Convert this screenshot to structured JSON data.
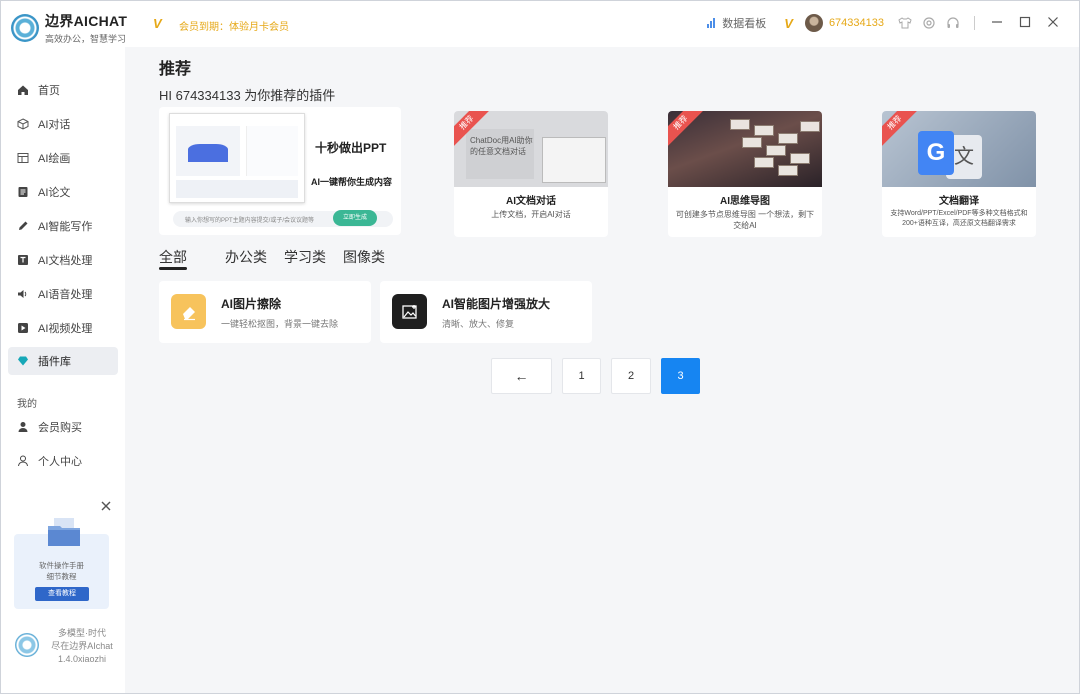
{
  "app": {
    "title": "边界AICHAT",
    "subtitle": "高效办公，智慧学习"
  },
  "topbar": {
    "vip_icon": "V",
    "vip_expiry": "会员到期：体验月卡会员",
    "dashboard": "数据看板",
    "user_id": "674334133",
    "accent": "#e6a817"
  },
  "sidebar": {
    "items": [
      {
        "label": "首页",
        "icon": "home-icon"
      },
      {
        "label": "AI对话",
        "icon": "cube-icon"
      },
      {
        "label": "AI绘画",
        "icon": "image-icon"
      },
      {
        "label": "AI论文",
        "icon": "document-icon"
      },
      {
        "label": "AI智能写作",
        "icon": "pen-icon"
      },
      {
        "label": "AI文档处理",
        "icon": "doc-text-icon"
      },
      {
        "label": "AI语音处理",
        "icon": "speaker-icon"
      },
      {
        "label": "AI视频处理",
        "icon": "play-icon"
      },
      {
        "label": "插件库",
        "icon": "gem-icon"
      }
    ],
    "section_label": "我的",
    "mine_items": [
      {
        "label": "会员购买",
        "icon": "user-icon"
      },
      {
        "label": "个人中心",
        "icon": "user-outline-icon"
      }
    ],
    "promo": {
      "line1": "软件操作手册",
      "line2": "细节教程",
      "button": "查看教程"
    },
    "version": {
      "line1": "多模型·时代",
      "line2": "尽在边界AIchat",
      "line3": "1.4.0xiaozhi"
    }
  },
  "main": {
    "title": "推荐",
    "greeting": "HI 674334133 为你推荐的插件",
    "banner": {
      "headline": "十秒做出PPT",
      "subline": "AI一键帮你生成内容",
      "input_hint": "输入你想写的PPT主题内容提交/或子/会议议题等",
      "button": "立即生成"
    },
    "cards": [
      {
        "badge": "推荐",
        "image_text_1": "ChatDoc用AI助你",
        "image_text_2": "的任意文档对话",
        "title": "AI文档对话",
        "desc": "上传文档，开启AI对话"
      },
      {
        "badge": "推荐",
        "title": "AI思维导图",
        "desc": "可创建多节点思维导图 一个想法，剩下交给AI"
      },
      {
        "badge": "推荐",
        "title": "文档翻译",
        "desc": "支持Word/PPT/Excel/PDF等多种文档格式和200+语种互译，高还原文档翻译需求"
      }
    ],
    "tabs": [
      "全部",
      "办公类",
      "学习类",
      "图像类"
    ],
    "plugins": [
      {
        "name": "AI图片擦除",
        "desc": "一键轻松抠图，背景一键去除",
        "icon": "eraser-icon",
        "icon_color": "#f7c35c"
      },
      {
        "name": "AI智能图片增强放大",
        "desc": "清晰、放大、修复",
        "icon": "image-enhance-icon",
        "icon_color": "#1f1f1f"
      }
    ],
    "pagination": {
      "prev": "←",
      "pages": [
        "1",
        "2",
        "3"
      ],
      "current": "3",
      "accent": "#1685f2"
    }
  }
}
